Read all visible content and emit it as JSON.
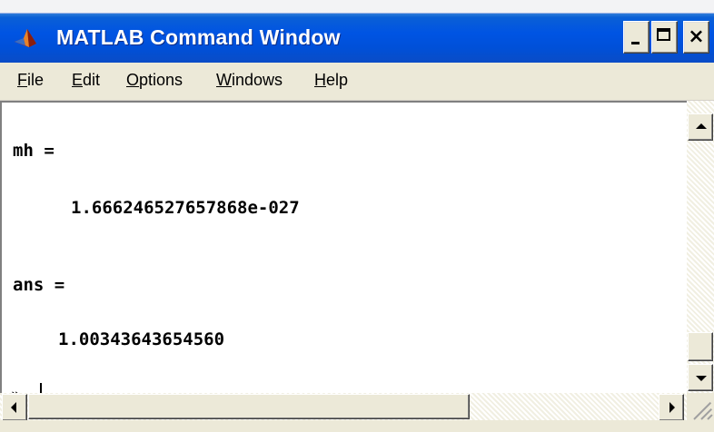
{
  "window": {
    "title": "MATLAB Command Window",
    "title_color": "#ffffff",
    "titlebar_color": "#0054e3"
  },
  "title_buttons": {
    "close_glyph": "×"
  },
  "menu": {
    "items": [
      {
        "mnemonic": "F",
        "rest": "ile"
      },
      {
        "mnemonic": "E",
        "rest": "dit"
      },
      {
        "mnemonic": "O",
        "rest": "ptions"
      },
      {
        "mnemonic": "W",
        "rest": "indows"
      },
      {
        "mnemonic": "H",
        "rest": "elp"
      }
    ]
  },
  "console": {
    "lines": {
      "mh_label": "mh =",
      "mh_value": "1.666246527657868e-027",
      "ans_label": "ans =",
      "ans_value": "1.00343643654560",
      "prompt": "»"
    }
  },
  "icons": {
    "app": "matlab-logo-icon",
    "minimize": "minimize-icon",
    "maximize": "maximize-icon",
    "close": "close-icon",
    "scroll_up": "arrow-up-icon",
    "scroll_down": "arrow-down-icon",
    "scroll_left": "arrow-left-icon",
    "scroll_right": "arrow-right-icon",
    "resize_grip": "resize-grip-icon"
  }
}
